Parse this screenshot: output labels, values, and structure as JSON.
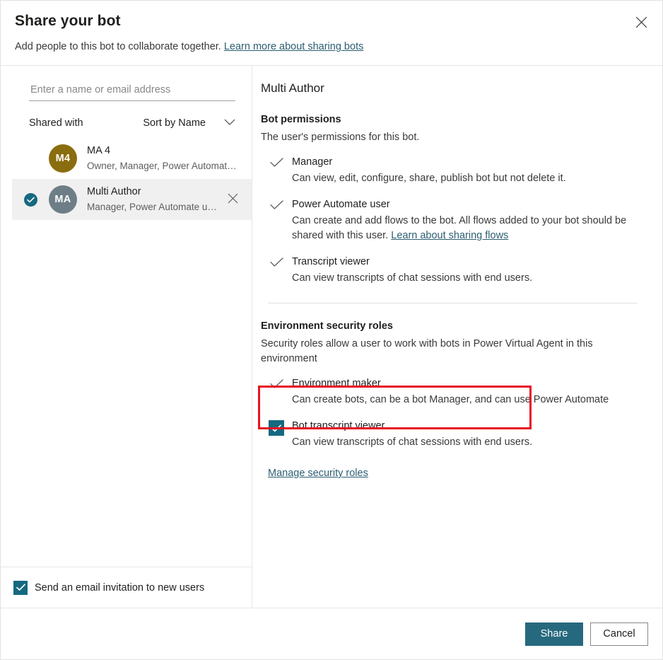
{
  "header": {
    "title": "Share your bot",
    "subtitle_text": "Add people to this bot to collaborate together.",
    "subtitle_link": "Learn more about sharing bots",
    "close_icon": "close-icon"
  },
  "left": {
    "search": {
      "placeholder": "Enter a name or email address",
      "value": ""
    },
    "list_header": {
      "label": "Shared with",
      "sort_label": "Sort by Name",
      "chevron_icon": "chevron-down-icon"
    },
    "people": [
      {
        "initials": "M4",
        "name": "MA 4",
        "roles": "Owner, Manager, Power Automate us...",
        "avatar_color": "#8a6d0e",
        "selected": false,
        "removable": false
      },
      {
        "initials": "MA",
        "name": "Multi Author",
        "roles": "Manager, Power Automate user",
        "avatar_color": "#6e7e87",
        "selected": true,
        "removable": true
      }
    ],
    "email_invite": {
      "label": "Send an email invitation to new users",
      "checked": true
    }
  },
  "right": {
    "user_title": "Multi Author",
    "bot_permissions": {
      "title": "Bot permissions",
      "description": "The user's permissions for this bot.",
      "items": [
        {
          "name": "Manager",
          "description": "Can view, edit, configure, share, publish bot but not delete it.",
          "link_text": "",
          "checked": true,
          "style": "checkmark"
        },
        {
          "name": "Power Automate user",
          "description": "Can create and add flows to the bot. All flows added to your bot should be shared with this user.",
          "link_text": "Learn about sharing flows",
          "checked": true,
          "style": "checkmark"
        },
        {
          "name": "Transcript viewer",
          "description": "Can view transcripts of chat sessions with end users.",
          "link_text": "",
          "checked": true,
          "style": "checkmark"
        }
      ]
    },
    "environment_roles": {
      "title": "Environment security roles",
      "description": "Security roles allow a user to work with bots in Power Virtual Agent in this environment",
      "items": [
        {
          "name": "Environment maker",
          "description": "Can create bots, can be a bot Manager, and can use Power Automate",
          "checked": true,
          "style": "checkmark",
          "highlighted": false
        },
        {
          "name": "Bot transcript viewer",
          "description": "Can view transcripts of chat sessions with end users.",
          "checked": true,
          "style": "checkbox",
          "highlighted": true
        }
      ],
      "manage_link": "Manage security roles"
    }
  },
  "footer": {
    "primary_button": "Share",
    "secondary_button": "Cancel"
  },
  "colors": {
    "accent_teal": "#15697f",
    "button_teal": "#26697e",
    "link_blue": "#2c5e72",
    "highlight_red": "#e81123",
    "avatar_gold": "#8a6d0e",
    "avatar_gray": "#6e7e87"
  }
}
